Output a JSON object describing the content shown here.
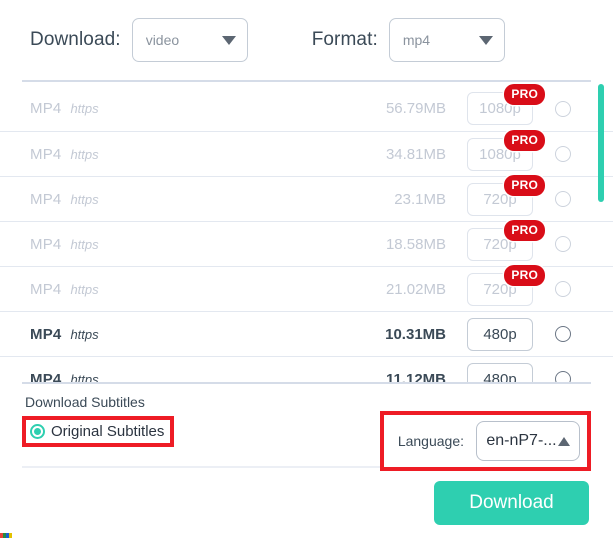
{
  "header": {
    "download_label": "Download:",
    "download_value": "video",
    "format_label": "Format:",
    "format_value": "mp4"
  },
  "list": {
    "rows": [
      {
        "format": "MP4",
        "protocol": "https",
        "size": "56.79MB",
        "quality": "1080p",
        "pro": true,
        "badge": "PRO"
      },
      {
        "format": "MP4",
        "protocol": "https",
        "size": "34.81MB",
        "quality": "1080p",
        "pro": true,
        "badge": "PRO"
      },
      {
        "format": "MP4",
        "protocol": "https",
        "size": "23.1MB",
        "quality": "720p",
        "pro": true,
        "badge": "PRO"
      },
      {
        "format": "MP4",
        "protocol": "https",
        "size": "18.58MB",
        "quality": "720p",
        "pro": true,
        "badge": "PRO"
      },
      {
        "format": "MP4",
        "protocol": "https",
        "size": "21.02MB",
        "quality": "720p",
        "pro": true,
        "badge": "PRO"
      },
      {
        "format": "MP4",
        "protocol": "https",
        "size": "10.31MB",
        "quality": "480p",
        "pro": false,
        "badge": ""
      },
      {
        "format": "MP4",
        "protocol": "https",
        "size": "11.12MB",
        "quality": "480p",
        "pro": false,
        "badge": ""
      }
    ]
  },
  "subtitles": {
    "section_label": "Download Subtitles",
    "original_label": "Original Subtitles",
    "original_selected": true,
    "language_label": "Language:",
    "language_value": "en-nP7-..."
  },
  "footer": {
    "download_button": "Download"
  },
  "colors": {
    "accent": "#2ecfb0",
    "pro_badge": "#d90d18",
    "highlight": "#ee1c25",
    "text": "#3b4a57",
    "muted": "#c3c9d4"
  }
}
